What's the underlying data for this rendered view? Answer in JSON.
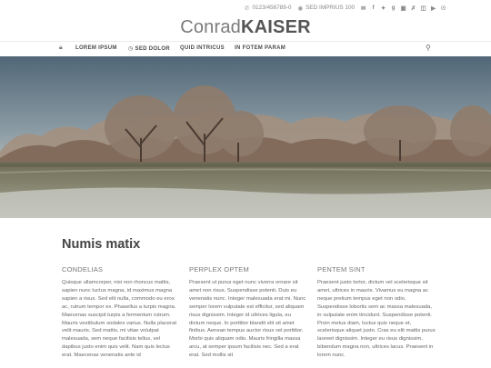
{
  "topbar": {
    "phone": "0123/456789-0",
    "address": "SED IMPRIUS 100",
    "icons": [
      "phone-icon",
      "location-pin-icon",
      "mail-icon",
      "facebook-icon",
      "twitter-icon",
      "google-plus-icon",
      "linkedin-icon",
      "xing-icon",
      "instagram-icon",
      "youtube-icon",
      "pinterest-icon"
    ]
  },
  "logo": {
    "light": "Conrad",
    "bold": "KAISER"
  },
  "nav": {
    "items": [
      {
        "label": "LOREM IPSUM"
      },
      {
        "label": "SED DOLOR"
      },
      {
        "label": "QUID INTRICUS"
      },
      {
        "label": "IN FOTEM PARAM"
      }
    ]
  },
  "main": {
    "title": "Numis matix",
    "columns": [
      {
        "heading": "CONDELIAS",
        "text": "Quisque ullamcorper, nisi non rhoncus mattis, sapien nunc luctus magna, id maximus magna sapien a risus. Sed elit nulla, commodo eu eros ac, rutrum tempor ex. Phasellus a turpis magna. Maecenas suscipit turpis a fermentum rutrum. Mauris vestibulum sodales varius. Nulla placerat velit mauris. Sed mattis, mi vitae volutpat malesuada, sem neque facilisis tellus, vel dapibus justo enim quis velit. Nam quis lectus erat. Maecenas venenatis ante id"
      },
      {
        "heading": "PERPLEX OPTEM",
        "text": "Praesent ut purus eget nunc viverra ornare sit amet non risus. Suspendisse potenti. Duis eu venenatis nunc. Integer malesuada erat mi. Nunc semper lorem vulputate est efficitur, sed aliquam risus dignissim. Integer id ultrices ligula, eu dictum neque. In porttitor blandit elit sit amet finibus. Aenean tempus auctor risus vel porttitor. Morbi quis aliquam odio. Mauris fringilla massa arcu, at semper ipsum facilisis nec. Sed a erat erat. Sed mollis sit"
      },
      {
        "heading": "PENTEM SINT",
        "text": "Praesent justo tortor, dictum vel scelerisque sit amet, ultrices in mauris. Vivamus eu magna ac neque pretium tempus eget non odio. Suspendisse lobortis sem ac massa malesuada, in vulputate enim tincidunt. Suspendisse potenti. Proin metus diam, luctus quis neque et, scelerisque aliquet justo. Cras eu elit mattis purus laoreet dignissim. Integer eu risus dignissim, bibendum magna non, ultrices lacus. Praesent in lorem nunc."
      }
    ]
  }
}
